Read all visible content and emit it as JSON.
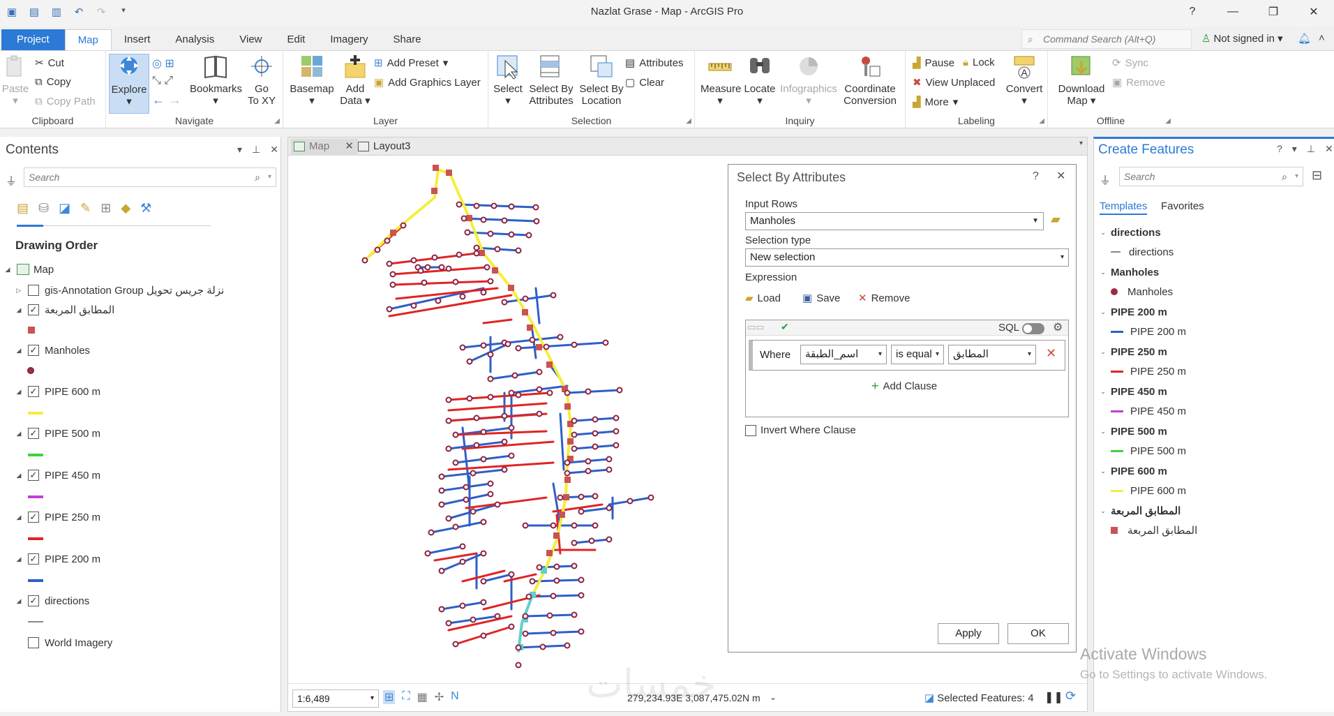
{
  "window": {
    "title": "Nazlat Grase - Map - ArcGIS Pro",
    "help": "?",
    "minimize": "—",
    "restore": "❐",
    "close": "✕"
  },
  "ribbon_tabs": [
    "Project",
    "Map",
    "Insert",
    "Analysis",
    "View",
    "Edit",
    "Imagery",
    "Share"
  ],
  "command_search": {
    "placeholder": "Command Search (Alt+Q)"
  },
  "account": {
    "label": "Not signed in"
  },
  "ribbon": {
    "clipboard": {
      "label": "Clipboard",
      "paste": "Paste",
      "cut": "Cut",
      "copy": "Copy",
      "copy_path": "Copy Path"
    },
    "navigate": {
      "label": "Navigate",
      "explore": "Explore",
      "bookmarks": "Bookmarks",
      "goto_xy_1": "Go",
      "goto_xy_2": "To XY"
    },
    "layer": {
      "label": "Layer",
      "basemap": "Basemap",
      "add_data_1": "Add",
      "add_data_2": "Data",
      "add_preset": "Add Preset",
      "add_graphics": "Add Graphics Layer"
    },
    "selection": {
      "label": "Selection",
      "select": "Select",
      "sba_1": "Select By",
      "sba_2": "Attributes",
      "sbl_1": "Select By",
      "sbl_2": "Location",
      "attributes": "Attributes",
      "clear": "Clear"
    },
    "inquiry": {
      "label": "Inquiry",
      "measure": "Measure",
      "locate": "Locate",
      "infographics": "Infographics",
      "coord_1": "Coordinate",
      "coord_2": "Conversion"
    },
    "labeling": {
      "label": "Labeling",
      "pause": "Pause",
      "lock": "Lock",
      "view_unplaced": "View Unplaced",
      "more": "More",
      "convert": "Convert"
    },
    "offline": {
      "label": "Offline",
      "download_1": "Download",
      "download_2": "Map",
      "sync": "Sync",
      "remove": "Remove"
    }
  },
  "contents": {
    "title": "Contents",
    "search_placeholder": "Search",
    "drawing_order": "Drawing Order",
    "layers": [
      {
        "name": "Map",
        "checked": null
      },
      {
        "name": "gis-Annotation Group نزلة جريس تحويل",
        "checked": false
      },
      {
        "name": "المطابق المربعة",
        "checked": true
      },
      {
        "name": "Manholes",
        "checked": true
      },
      {
        "name": "PIPE 600 m",
        "checked": true,
        "color": "#f5ee3c"
      },
      {
        "name": "PIPE 500 m",
        "checked": true,
        "color": "#3fd23f"
      },
      {
        "name": "PIPE 450 m",
        "checked": true,
        "color": "#c23fd6"
      },
      {
        "name": "PIPE 250 m",
        "checked": true,
        "color": "#e02424"
      },
      {
        "name": "PIPE 200 m",
        "checked": true,
        "color": "#2d5fc9"
      },
      {
        "name": "directions",
        "checked": true,
        "color": "#888888"
      },
      {
        "name": "World Imagery",
        "checked": false
      }
    ]
  },
  "view": {
    "tabs": [
      "Map",
      "Layout3"
    ],
    "scale": "1:6,489",
    "coordinates": "279,234.93E 3,087,475.02N m",
    "selected_features": "Selected Features: 4"
  },
  "dialog": {
    "title": "Select By Attributes",
    "input_rows_label": "Input Rows",
    "input_rows_value": "Manholes",
    "selection_type_label": "Selection type",
    "selection_type_value": "New selection",
    "expression_label": "Expression",
    "load": "Load",
    "save": "Save",
    "remove": "Remove",
    "sql": "SQL",
    "where": "Where",
    "field": "اسم_الطبقة",
    "operator": "is equal",
    "value": "المطابق",
    "add_clause": "Add Clause",
    "invert": "Invert Where Clause",
    "apply": "Apply",
    "ok": "OK"
  },
  "create_features": {
    "title": "Create Features",
    "search_placeholder": "Search",
    "tab_templates": "Templates",
    "tab_favorites": "Favorites",
    "groups": [
      {
        "header": "directions",
        "item": "directions",
        "sym": "line",
        "color": "#888888"
      },
      {
        "header": "Manholes",
        "item": "Manholes",
        "sym": "dot",
        "color": "#9b2d44"
      },
      {
        "header": "PIPE 200 m",
        "item": "PIPE 200 m",
        "sym": "line",
        "color": "#2d5fc9"
      },
      {
        "header": "PIPE 250 m",
        "item": "PIPE 250 m",
        "sym": "line",
        "color": "#e02424"
      },
      {
        "header": "PIPE 450 m",
        "item": "PIPE 450 m",
        "sym": "line",
        "color": "#c23fd6"
      },
      {
        "header": "PIPE 500 m",
        "item": "PIPE 500 m",
        "sym": "line",
        "color": "#3fd23f"
      },
      {
        "header": "PIPE 600 m",
        "item": "PIPE 600 m",
        "sym": "line",
        "color": "#f5ee3c"
      },
      {
        "header": "المطابق المربعة",
        "item": "المطابق المربعة",
        "sym": "square",
        "color": "#c95353"
      }
    ]
  },
  "watermark": {
    "line1": "Activate Windows",
    "line2": "Go to Settings to activate Windows.",
    "arabic_logo": "خمسات"
  }
}
